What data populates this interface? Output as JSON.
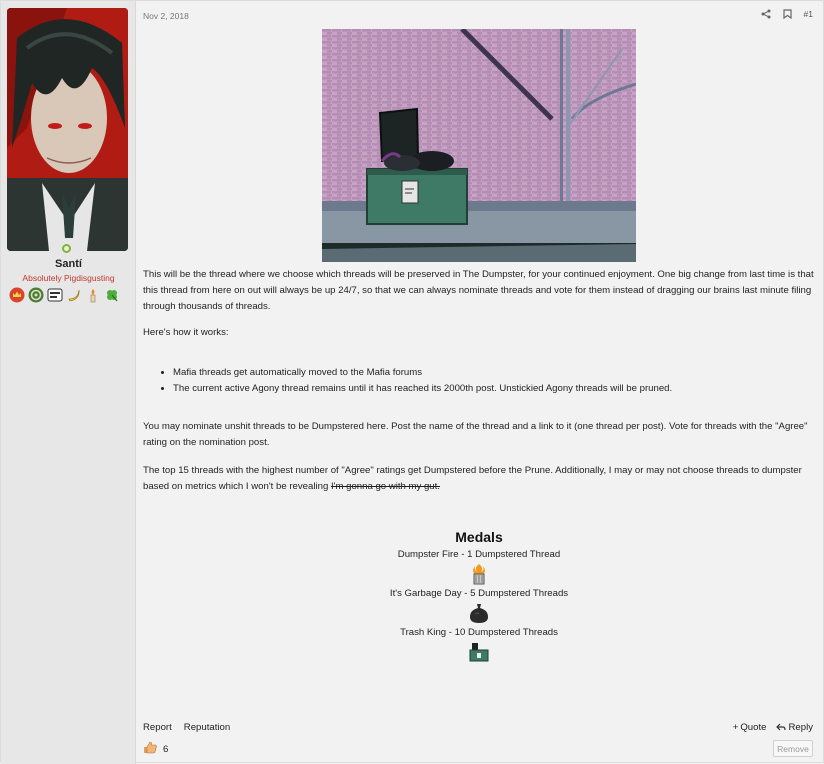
{
  "user": {
    "name": "Santí",
    "title": "Absolutely Pigdisgusting",
    "badges": [
      "crown-badge-icon",
      "spiral-badge-icon",
      "flag-badge-icon",
      "banana-badge-icon",
      "torch-badge-icon",
      "clover-badge-icon"
    ]
  },
  "post": {
    "date": "Nov 2, 2018",
    "number": "#1",
    "paragraph1": "This will be the thread where we choose which threads will be preserved in The Dumpster, for your continued enjoyment. One big change from last time is that this thread from here on out will always be up 24/7, so that we can always nominate threads and vote for them instead of dragging our brains last minute filing through thousands of threads.",
    "paragraph2": "Here's how it works:",
    "list": [
      "Mafia threads get automatically moved to the Mafia forums",
      "The current active Agony thread remains until it has reached its 2000th post. Unstickied Agony threads will be pruned."
    ],
    "paragraph3": "You may nominate unshit threads to be Dumpstered here. Post the name of the thread and a link to it (one thread per post). Vote for threads with the \"Agree\" rating on the nomination post.",
    "paragraph4": "The top 15 threads with the highest number of \"Agree\" ratings get Dumpstered before the Prune. Additionally, I may or may not choose threads to dumpster based on metrics which I won't be revealing",
    "paragraph4_strike": "I'm gonna go with my gut."
  },
  "medals": {
    "title": "Medals",
    "items": [
      {
        "label": "Dumpster Fire - 1 Dumpstered Thread",
        "icon": "fire-bin-icon"
      },
      {
        "label": "It's Garbage Day - 5 Dumpstered Threads",
        "icon": "garbage-bag-icon"
      },
      {
        "label": "Trash King - 10 Dumpstered Threads",
        "icon": "dumpster-icon"
      }
    ]
  },
  "footer": {
    "report": "Report",
    "reputation": "Reputation",
    "quote": "Quote",
    "reply": "Reply",
    "reaction_count": "6",
    "remove": "Remove"
  }
}
